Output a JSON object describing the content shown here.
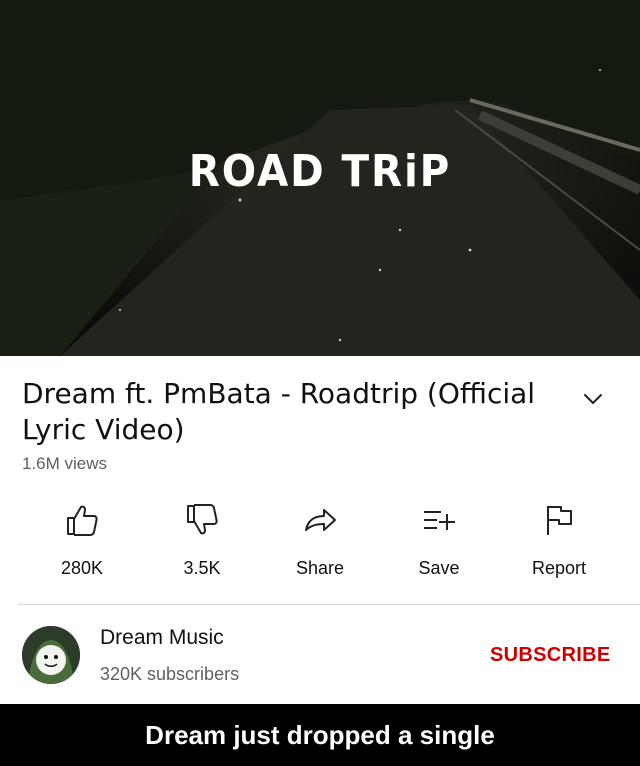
{
  "video": {
    "title_overlay": "ROAD TRiP"
  },
  "details": {
    "title": "Dream ft. PmBata - Roadtrip (Official Lyric Video)",
    "views": "1.6M views"
  },
  "actions": {
    "like": {
      "label": "280K",
      "icon": "thumbs-up-icon"
    },
    "dislike": {
      "label": "3.5K",
      "icon": "thumbs-down-icon"
    },
    "share": {
      "label": "Share",
      "icon": "share-arrow-icon"
    },
    "save": {
      "label": "Save",
      "icon": "add-to-playlist-icon"
    },
    "report": {
      "label": "Report",
      "icon": "flag-icon"
    }
  },
  "channel": {
    "name": "Dream Music",
    "subscribers": "320K subscribers",
    "subscribe_label": "SUBSCRIBE"
  },
  "caption": {
    "text": "Dream just dropped a single"
  },
  "colors": {
    "subscribe": "#cc0000",
    "caption_bg": "#000000",
    "secondary_text": "#606060"
  }
}
